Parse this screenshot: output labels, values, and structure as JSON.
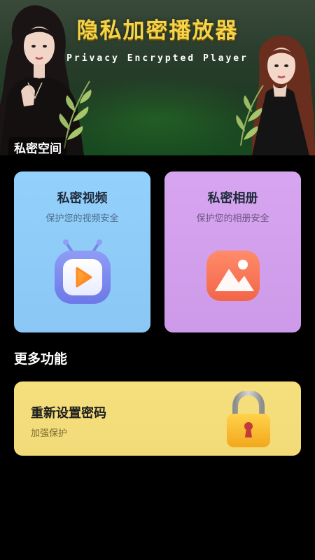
{
  "banner": {
    "title": "隐私加密播放器",
    "subtitle": "Privacy Encrypted Player",
    "section_label": "私密空间"
  },
  "cards": {
    "video": {
      "title": "私密视频",
      "subtitle": "保护您的视频安全",
      "icon": "tv-play-icon"
    },
    "album": {
      "title": "私密相册",
      "subtitle": "保护您的相册安全",
      "icon": "image-album-icon"
    }
  },
  "more": {
    "section_title": "更多功能",
    "reset": {
      "title": "重新设置密码",
      "subtitle": "加强保护",
      "icon": "padlock-icon"
    }
  },
  "colors": {
    "title_gold": "#f5d34a",
    "video_card": "#8bc7f5",
    "album_card": "#d2a0ec",
    "reset_card": "#f3dc7a",
    "background": "#000000"
  }
}
